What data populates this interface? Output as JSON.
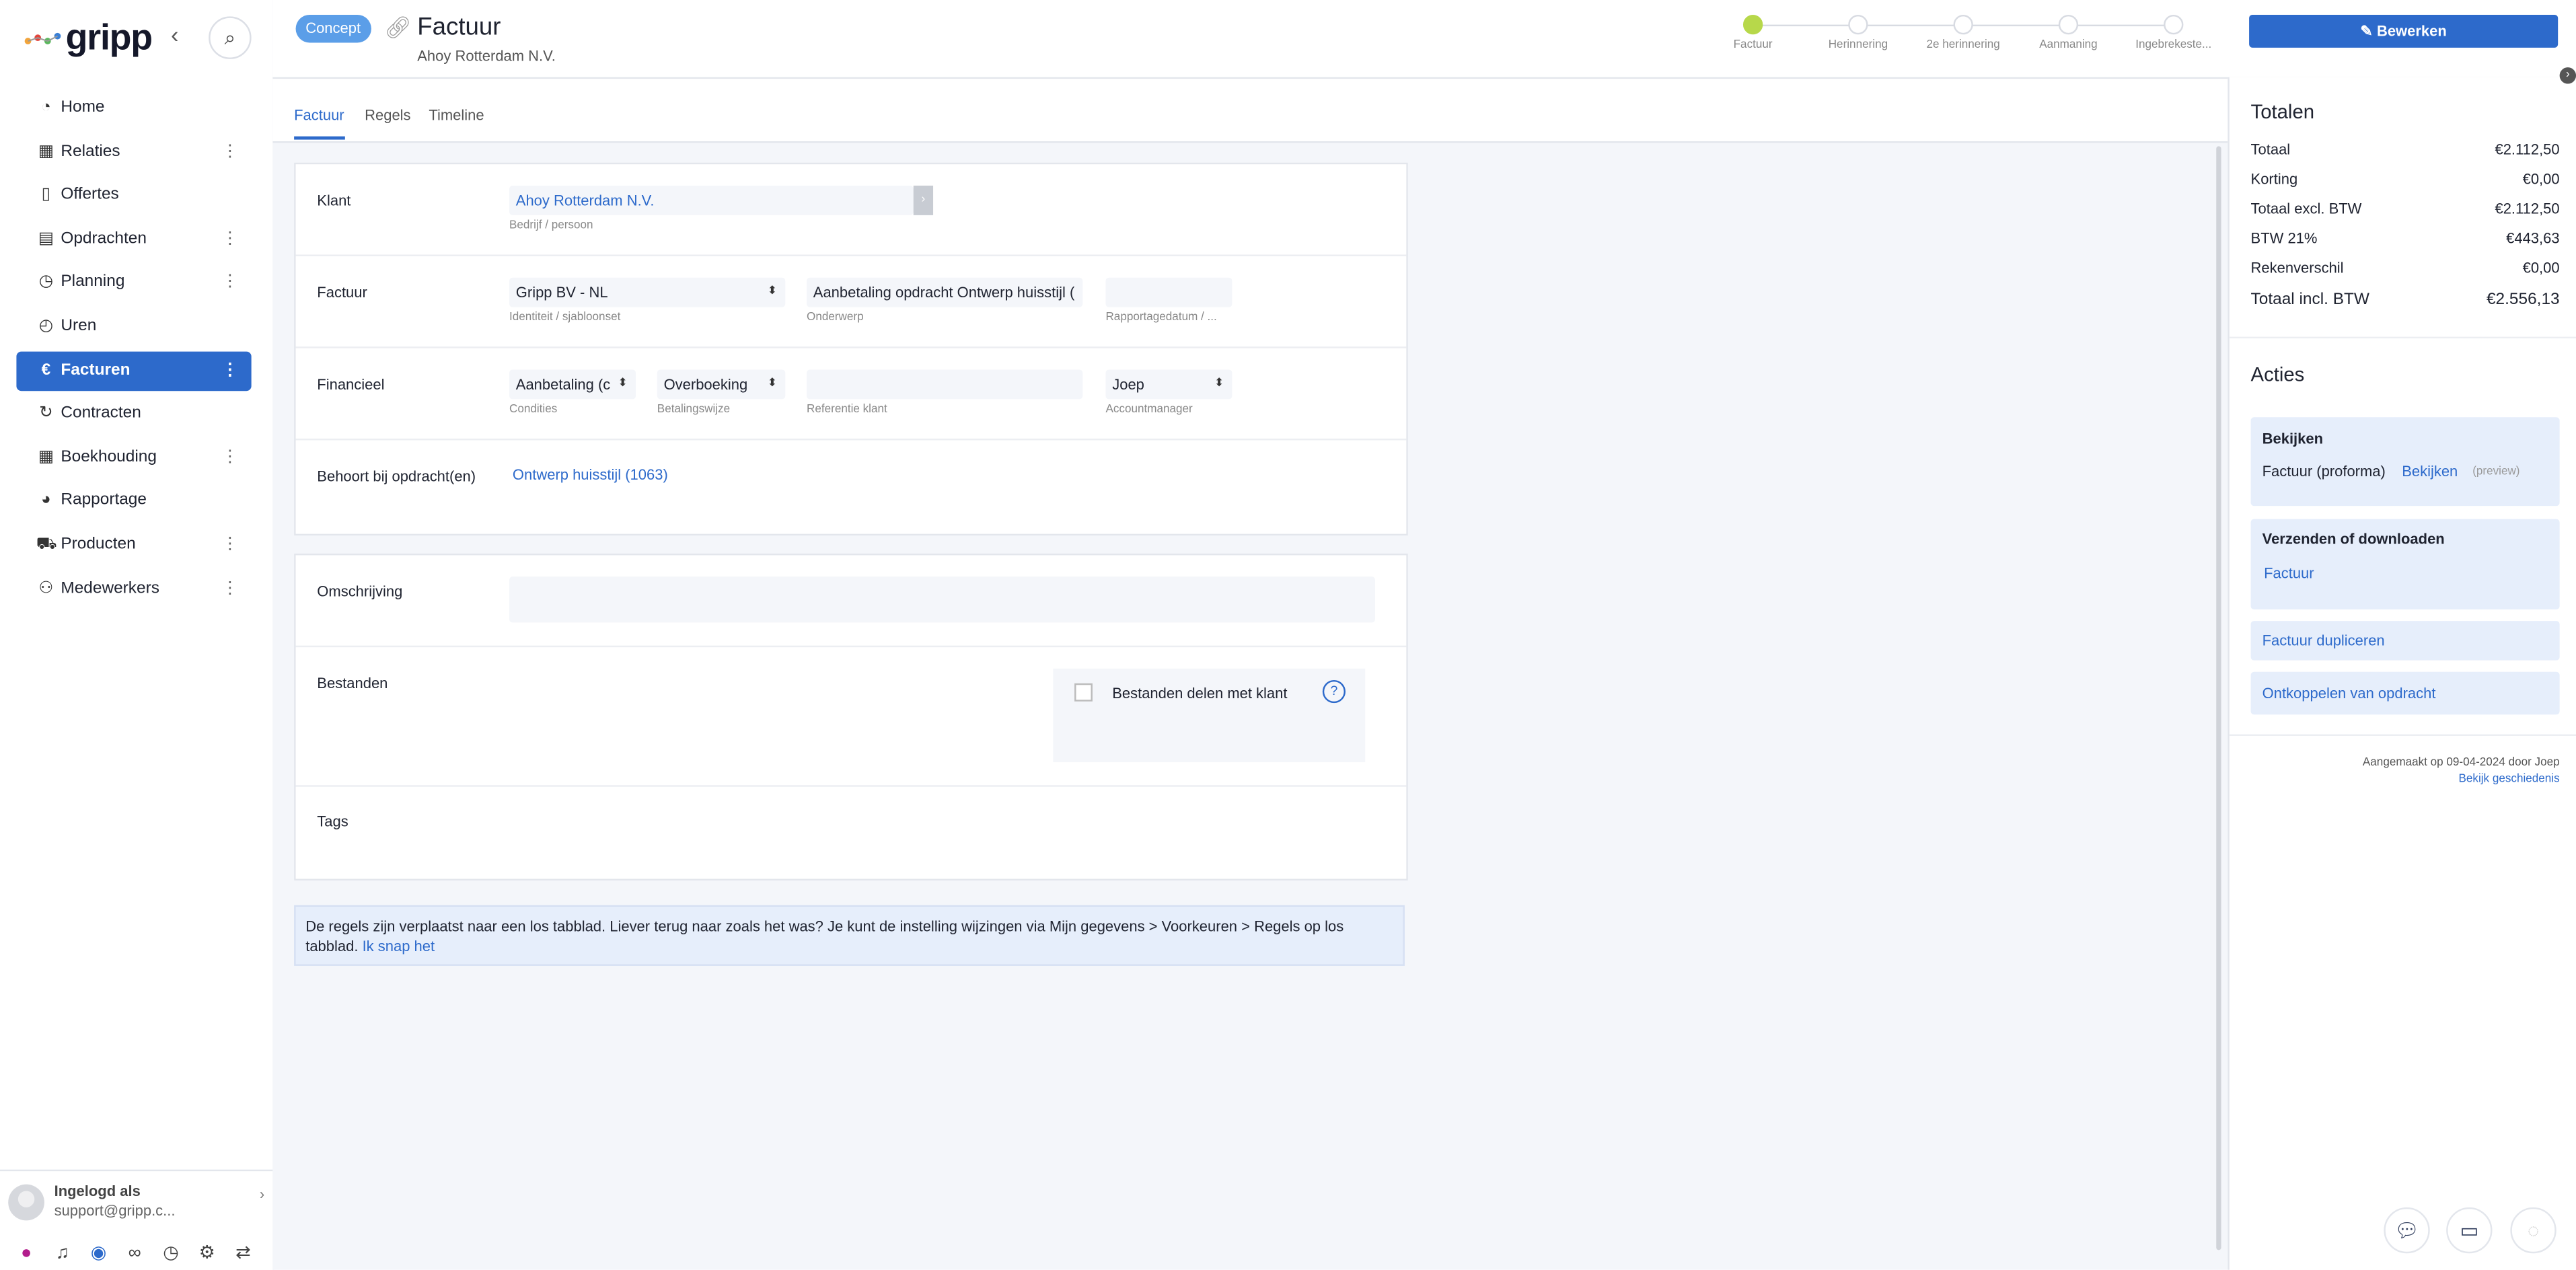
{
  "brand": {
    "name": "gripp"
  },
  "sidebar": {
    "items": [
      {
        "label": "Home",
        "icon": "dashboard-icon",
        "more": false
      },
      {
        "label": "Relaties",
        "icon": "building-icon",
        "more": true
      },
      {
        "label": "Offertes",
        "icon": "document-icon",
        "more": false
      },
      {
        "label": "Opdrachten",
        "icon": "clipboard-icon",
        "more": true
      },
      {
        "label": "Planning",
        "icon": "clock-icon",
        "more": true
      },
      {
        "label": "Uren",
        "icon": "stopwatch-icon",
        "more": false
      },
      {
        "label": "Facturen",
        "icon": "euro-icon",
        "more": true,
        "active": true
      },
      {
        "label": "Contracten",
        "icon": "refresh-icon",
        "more": false
      },
      {
        "label": "Boekhouding",
        "icon": "grid-icon",
        "more": true
      },
      {
        "label": "Rapportage",
        "icon": "pie-chart-icon",
        "more": false
      },
      {
        "label": "Producten",
        "icon": "cart-icon",
        "more": true
      },
      {
        "label": "Medewerkers",
        "icon": "users-icon",
        "more": true
      }
    ],
    "user": {
      "label": "Ingelogd als",
      "email": "support@gripp.c..."
    }
  },
  "header": {
    "status_badge": "Concept",
    "title": "Factuur",
    "subtitle": "Ahoy Rotterdam N.V.",
    "steps": [
      "Factuur",
      "Herinnering",
      "2e herinnering",
      "Aanmaning",
      "Ingebrekeste..."
    ],
    "edit_label": "Bewerken"
  },
  "tabs": [
    "Factuur",
    "Regels",
    "Timeline"
  ],
  "form": {
    "klant": {
      "label": "Klant",
      "value": "Ahoy Rotterdam N.V.",
      "hint": "Bedrijf / persoon"
    },
    "factuur": {
      "label": "Factuur",
      "identity": "Gripp BV - NL",
      "identity_hint": "Identiteit / sjabloonset",
      "subject": "Aanbetaling opdracht Ontwerp huisstijl (",
      "subject_hint": "Onderwerp",
      "report_date": "",
      "report_date_hint": "Rapportagedatum / ..."
    },
    "financieel": {
      "label": "Financieel",
      "conditions": "Aanbetaling (c",
      "conditions_hint": "Condities",
      "payment": "Overboeking",
      "payment_hint": "Betalingswijze",
      "reference": "",
      "reference_hint": "Referentie klant",
      "manager": "Joep",
      "manager_hint": "Accountmanager"
    },
    "opdracht": {
      "label": "Behoort bij opdracht(en)",
      "value": "Ontwerp huisstijl (1063)"
    },
    "omschrijving": {
      "label": "Omschrijving",
      "value": ""
    },
    "bestanden": {
      "label": "Bestanden",
      "share_label": "Bestanden delen met klant"
    },
    "tags": {
      "label": "Tags"
    }
  },
  "notice": {
    "text": "De regels zijn verplaatst naar een los tabblad. Liever terug naar zoals het was? Je kunt de instelling wijzingen via Mijn gegevens > Voorkeuren > Regels op los tabblad.",
    "link": "Ik snap het"
  },
  "totals": {
    "title": "Totalen",
    "rows": [
      {
        "label": "Totaal",
        "value": "€2.112,50"
      },
      {
        "label": "Korting",
        "value": "€0,00"
      },
      {
        "label": "Totaal excl. BTW",
        "value": "€2.112,50"
      },
      {
        "label": "BTW 21%",
        "value": "€443,63"
      },
      {
        "label": "Rekenverschil",
        "value": "€0,00"
      }
    ],
    "grand": {
      "label": "Totaal incl. BTW",
      "value": "€2.556,13"
    }
  },
  "actions": {
    "title": "Acties",
    "view": {
      "title": "Bekijken",
      "item": "Factuur (proforma)",
      "link": "Bekijken",
      "note": "(preview)"
    },
    "send": {
      "title": "Verzenden of downloaden",
      "link": "Factuur"
    },
    "duplicate": "Factuur dupliceren",
    "unlink": "Ontkoppelen van opdracht"
  },
  "meta": {
    "created": "Aangemaakt op 09-04-2024 door Joep",
    "history": "Bekijk geschiedenis"
  },
  "colors": {
    "accent": "#2d6acb",
    "badge": "#5b9ee8",
    "step_done": "#b7d84a"
  }
}
